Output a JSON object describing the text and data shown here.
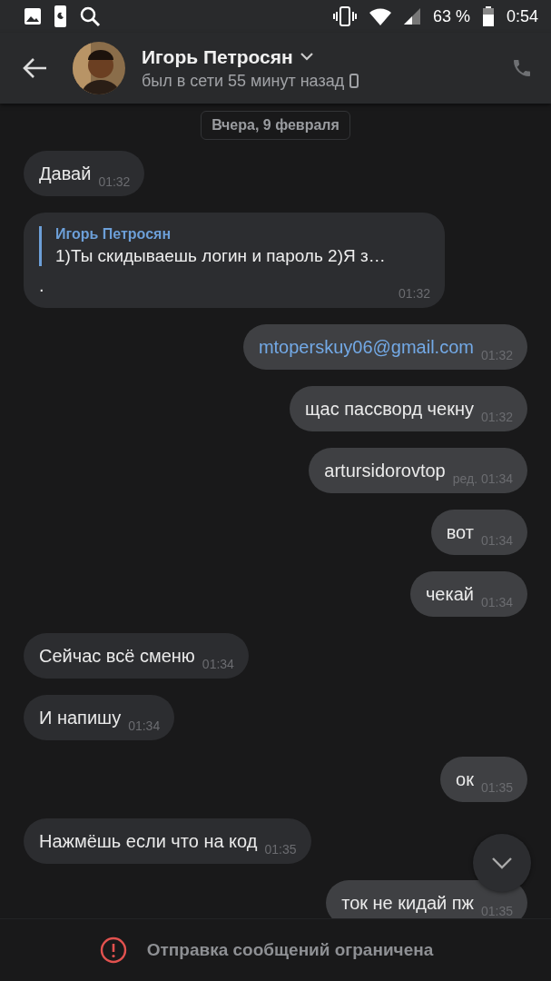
{
  "status_bar": {
    "battery": "63 %",
    "time": "0:54"
  },
  "header": {
    "name": "Игорь Петросян",
    "status": "был в сети 55 минут назад"
  },
  "date_chip": "Вчера, 9 февраля",
  "messages": [
    {
      "kind": "text",
      "outgoing": false,
      "text": "Давай",
      "time": "01:32"
    },
    {
      "kind": "reply",
      "outgoing": false,
      "quote_author": "Игорь Петросян",
      "quote_text": "1)Ты скидываешь логин и пароль  2)Я з…",
      "text": ".",
      "time": "01:32"
    },
    {
      "kind": "link",
      "outgoing": true,
      "text": "mtoperskuy06@gmail.com",
      "time": "01:32"
    },
    {
      "kind": "text",
      "outgoing": true,
      "text": "щас пассворд чекну",
      "time": "01:32"
    },
    {
      "kind": "text",
      "outgoing": true,
      "text": "artursidorovtop",
      "edited_label": "ред.",
      "time": "01:34"
    },
    {
      "kind": "text",
      "outgoing": true,
      "text": "вот",
      "time": "01:34"
    },
    {
      "kind": "text",
      "outgoing": true,
      "text": "чекай",
      "time": "01:34"
    },
    {
      "kind": "text",
      "outgoing": false,
      "text": "Сейчас всё сменю",
      "time": "01:34"
    },
    {
      "kind": "text",
      "outgoing": false,
      "text": "И напишу",
      "time": "01:34"
    },
    {
      "kind": "text",
      "outgoing": true,
      "text": "ок",
      "time": "01:35"
    },
    {
      "kind": "text",
      "outgoing": false,
      "text": "Нажмёшь если что на код",
      "time": "01:35"
    },
    {
      "kind": "text",
      "outgoing": true,
      "text": "ток не кидай пж",
      "time": "01:35"
    }
  ],
  "notice": "Отправка сообщений ограничена"
}
